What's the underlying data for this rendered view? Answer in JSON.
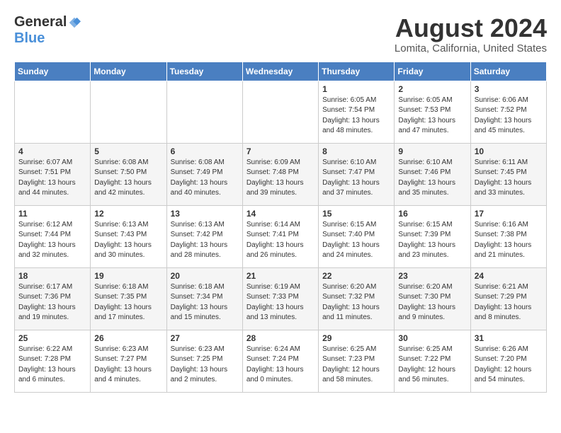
{
  "logo": {
    "general": "General",
    "blue": "Blue"
  },
  "title": "August 2024",
  "location": "Lomita, California, United States",
  "days_header": [
    "Sunday",
    "Monday",
    "Tuesday",
    "Wednesday",
    "Thursday",
    "Friday",
    "Saturday"
  ],
  "weeks": [
    [
      {
        "day": "",
        "info": ""
      },
      {
        "day": "",
        "info": ""
      },
      {
        "day": "",
        "info": ""
      },
      {
        "day": "",
        "info": ""
      },
      {
        "day": "1",
        "info": "Sunrise: 6:05 AM\nSunset: 7:54 PM\nDaylight: 13 hours\nand 48 minutes."
      },
      {
        "day": "2",
        "info": "Sunrise: 6:05 AM\nSunset: 7:53 PM\nDaylight: 13 hours\nand 47 minutes."
      },
      {
        "day": "3",
        "info": "Sunrise: 6:06 AM\nSunset: 7:52 PM\nDaylight: 13 hours\nand 45 minutes."
      }
    ],
    [
      {
        "day": "4",
        "info": "Sunrise: 6:07 AM\nSunset: 7:51 PM\nDaylight: 13 hours\nand 44 minutes."
      },
      {
        "day": "5",
        "info": "Sunrise: 6:08 AM\nSunset: 7:50 PM\nDaylight: 13 hours\nand 42 minutes."
      },
      {
        "day": "6",
        "info": "Sunrise: 6:08 AM\nSunset: 7:49 PM\nDaylight: 13 hours\nand 40 minutes."
      },
      {
        "day": "7",
        "info": "Sunrise: 6:09 AM\nSunset: 7:48 PM\nDaylight: 13 hours\nand 39 minutes."
      },
      {
        "day": "8",
        "info": "Sunrise: 6:10 AM\nSunset: 7:47 PM\nDaylight: 13 hours\nand 37 minutes."
      },
      {
        "day": "9",
        "info": "Sunrise: 6:10 AM\nSunset: 7:46 PM\nDaylight: 13 hours\nand 35 minutes."
      },
      {
        "day": "10",
        "info": "Sunrise: 6:11 AM\nSunset: 7:45 PM\nDaylight: 13 hours\nand 33 minutes."
      }
    ],
    [
      {
        "day": "11",
        "info": "Sunrise: 6:12 AM\nSunset: 7:44 PM\nDaylight: 13 hours\nand 32 minutes."
      },
      {
        "day": "12",
        "info": "Sunrise: 6:13 AM\nSunset: 7:43 PM\nDaylight: 13 hours\nand 30 minutes."
      },
      {
        "day": "13",
        "info": "Sunrise: 6:13 AM\nSunset: 7:42 PM\nDaylight: 13 hours\nand 28 minutes."
      },
      {
        "day": "14",
        "info": "Sunrise: 6:14 AM\nSunset: 7:41 PM\nDaylight: 13 hours\nand 26 minutes."
      },
      {
        "day": "15",
        "info": "Sunrise: 6:15 AM\nSunset: 7:40 PM\nDaylight: 13 hours\nand 24 minutes."
      },
      {
        "day": "16",
        "info": "Sunrise: 6:15 AM\nSunset: 7:39 PM\nDaylight: 13 hours\nand 23 minutes."
      },
      {
        "day": "17",
        "info": "Sunrise: 6:16 AM\nSunset: 7:38 PM\nDaylight: 13 hours\nand 21 minutes."
      }
    ],
    [
      {
        "day": "18",
        "info": "Sunrise: 6:17 AM\nSunset: 7:36 PM\nDaylight: 13 hours\nand 19 minutes."
      },
      {
        "day": "19",
        "info": "Sunrise: 6:18 AM\nSunset: 7:35 PM\nDaylight: 13 hours\nand 17 minutes."
      },
      {
        "day": "20",
        "info": "Sunrise: 6:18 AM\nSunset: 7:34 PM\nDaylight: 13 hours\nand 15 minutes."
      },
      {
        "day": "21",
        "info": "Sunrise: 6:19 AM\nSunset: 7:33 PM\nDaylight: 13 hours\nand 13 minutes."
      },
      {
        "day": "22",
        "info": "Sunrise: 6:20 AM\nSunset: 7:32 PM\nDaylight: 13 hours\nand 11 minutes."
      },
      {
        "day": "23",
        "info": "Sunrise: 6:20 AM\nSunset: 7:30 PM\nDaylight: 13 hours\nand 9 minutes."
      },
      {
        "day": "24",
        "info": "Sunrise: 6:21 AM\nSunset: 7:29 PM\nDaylight: 13 hours\nand 8 minutes."
      }
    ],
    [
      {
        "day": "25",
        "info": "Sunrise: 6:22 AM\nSunset: 7:28 PM\nDaylight: 13 hours\nand 6 minutes."
      },
      {
        "day": "26",
        "info": "Sunrise: 6:23 AM\nSunset: 7:27 PM\nDaylight: 13 hours\nand 4 minutes."
      },
      {
        "day": "27",
        "info": "Sunrise: 6:23 AM\nSunset: 7:25 PM\nDaylight: 13 hours\nand 2 minutes."
      },
      {
        "day": "28",
        "info": "Sunrise: 6:24 AM\nSunset: 7:24 PM\nDaylight: 13 hours\nand 0 minutes."
      },
      {
        "day": "29",
        "info": "Sunrise: 6:25 AM\nSunset: 7:23 PM\nDaylight: 12 hours\nand 58 minutes."
      },
      {
        "day": "30",
        "info": "Sunrise: 6:25 AM\nSunset: 7:22 PM\nDaylight: 12 hours\nand 56 minutes."
      },
      {
        "day": "31",
        "info": "Sunrise: 6:26 AM\nSunset: 7:20 PM\nDaylight: 12 hours\nand 54 minutes."
      }
    ]
  ]
}
